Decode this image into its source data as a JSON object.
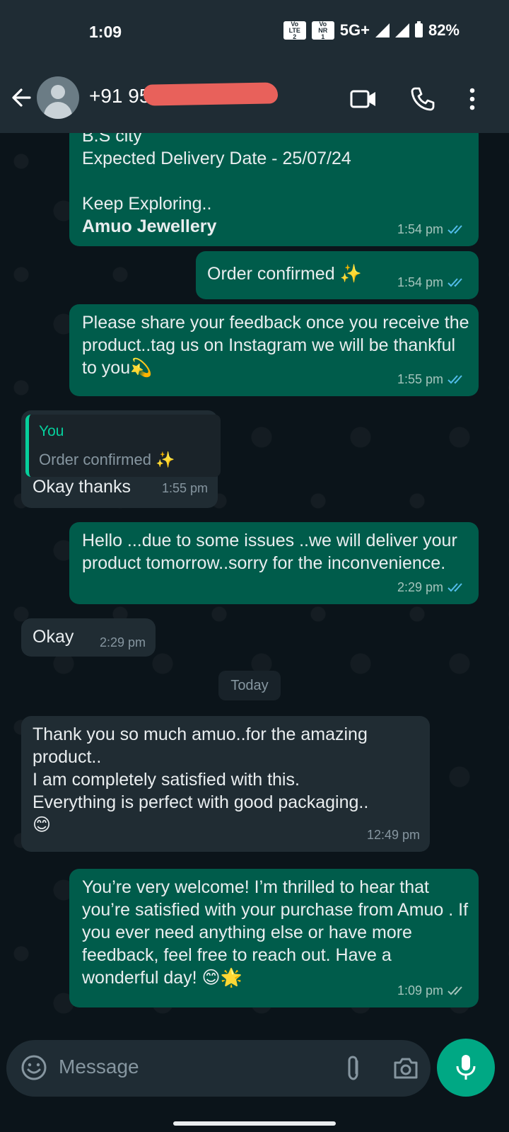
{
  "status_bar": {
    "time": "1:09",
    "sim1": [
      "Vo",
      "LTE",
      "2"
    ],
    "sim2": [
      "Vo",
      "NR",
      "1"
    ],
    "network": "5G+",
    "battery": "82%"
  },
  "header": {
    "contact": "+91 95"
  },
  "messages": {
    "m1": {
      "lines": "B.S city\nExpected Delivery Date - 25/07/24\n\nKeep Exploring..",
      "bold": "Amuo Jewellery",
      "time": "1:54 pm"
    },
    "m2": {
      "text": "Order confirmed ✨",
      "time": "1:54 pm"
    },
    "m3": {
      "text": "Please share your feedback once you receive the product..tag us on Instagram we will be thankful to you💫",
      "time": "1:55 pm"
    },
    "m4": {
      "quote_author": "You",
      "quote_text": "Order confirmed ✨",
      "text": "Okay thanks",
      "time": "1:55 pm"
    },
    "m5": {
      "text": "Hello ...due to some issues ..we will deliver your product tomorrow..sorry for the inconvenience.",
      "time": "2:29 pm"
    },
    "m6": {
      "text": "Okay",
      "time": "2:29 pm"
    },
    "m7": {
      "text": "Thank you so much amuo..for the amazing product..\nI am completely satisfied with this.\nEverything is perfect with good packaging..\n😊",
      "time": "12:49 pm"
    },
    "m8": {
      "text": "You’re very welcome! I’m thrilled to hear that you’re satisfied with your purchase from Amuo . If you ever need anything else or have more feedback, feel free to reach out. Have a wonderful day! 😊🌟",
      "time": "1:09 pm"
    }
  },
  "day_chip": "Today",
  "composer": {
    "placeholder": "Message"
  },
  "colors": {
    "outgoing": "#005c4b",
    "incoming": "#202c33",
    "accent": "#00a884",
    "read_tick": "#53bdeb"
  }
}
